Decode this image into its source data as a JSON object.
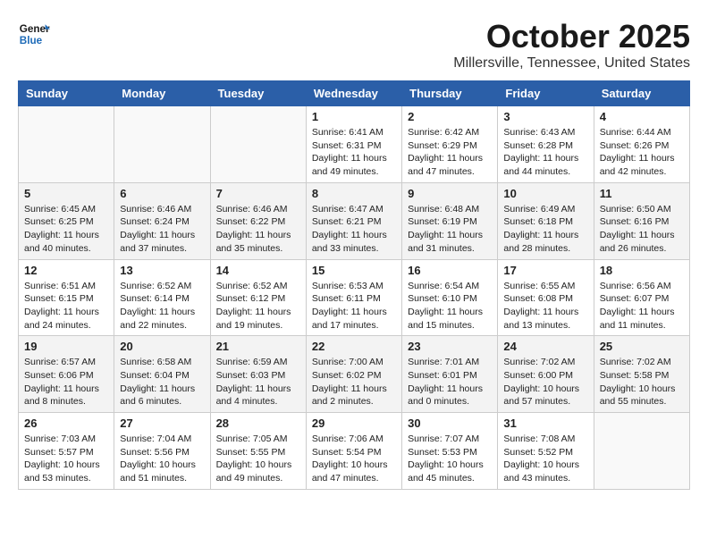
{
  "header": {
    "logo_line1": "General",
    "logo_line2": "Blue",
    "month_title": "October 2025",
    "location": "Millersville, Tennessee, United States"
  },
  "days_of_week": [
    "Sunday",
    "Monday",
    "Tuesday",
    "Wednesday",
    "Thursday",
    "Friday",
    "Saturday"
  ],
  "weeks": [
    [
      {
        "day": "",
        "info": ""
      },
      {
        "day": "",
        "info": ""
      },
      {
        "day": "",
        "info": ""
      },
      {
        "day": "1",
        "info": "Sunrise: 6:41 AM\nSunset: 6:31 PM\nDaylight: 11 hours\nand 49 minutes."
      },
      {
        "day": "2",
        "info": "Sunrise: 6:42 AM\nSunset: 6:29 PM\nDaylight: 11 hours\nand 47 minutes."
      },
      {
        "day": "3",
        "info": "Sunrise: 6:43 AM\nSunset: 6:28 PM\nDaylight: 11 hours\nand 44 minutes."
      },
      {
        "day": "4",
        "info": "Sunrise: 6:44 AM\nSunset: 6:26 PM\nDaylight: 11 hours\nand 42 minutes."
      }
    ],
    [
      {
        "day": "5",
        "info": "Sunrise: 6:45 AM\nSunset: 6:25 PM\nDaylight: 11 hours\nand 40 minutes."
      },
      {
        "day": "6",
        "info": "Sunrise: 6:46 AM\nSunset: 6:24 PM\nDaylight: 11 hours\nand 37 minutes."
      },
      {
        "day": "7",
        "info": "Sunrise: 6:46 AM\nSunset: 6:22 PM\nDaylight: 11 hours\nand 35 minutes."
      },
      {
        "day": "8",
        "info": "Sunrise: 6:47 AM\nSunset: 6:21 PM\nDaylight: 11 hours\nand 33 minutes."
      },
      {
        "day": "9",
        "info": "Sunrise: 6:48 AM\nSunset: 6:19 PM\nDaylight: 11 hours\nand 31 minutes."
      },
      {
        "day": "10",
        "info": "Sunrise: 6:49 AM\nSunset: 6:18 PM\nDaylight: 11 hours\nand 28 minutes."
      },
      {
        "day": "11",
        "info": "Sunrise: 6:50 AM\nSunset: 6:16 PM\nDaylight: 11 hours\nand 26 minutes."
      }
    ],
    [
      {
        "day": "12",
        "info": "Sunrise: 6:51 AM\nSunset: 6:15 PM\nDaylight: 11 hours\nand 24 minutes."
      },
      {
        "day": "13",
        "info": "Sunrise: 6:52 AM\nSunset: 6:14 PM\nDaylight: 11 hours\nand 22 minutes."
      },
      {
        "day": "14",
        "info": "Sunrise: 6:52 AM\nSunset: 6:12 PM\nDaylight: 11 hours\nand 19 minutes."
      },
      {
        "day": "15",
        "info": "Sunrise: 6:53 AM\nSunset: 6:11 PM\nDaylight: 11 hours\nand 17 minutes."
      },
      {
        "day": "16",
        "info": "Sunrise: 6:54 AM\nSunset: 6:10 PM\nDaylight: 11 hours\nand 15 minutes."
      },
      {
        "day": "17",
        "info": "Sunrise: 6:55 AM\nSunset: 6:08 PM\nDaylight: 11 hours\nand 13 minutes."
      },
      {
        "day": "18",
        "info": "Sunrise: 6:56 AM\nSunset: 6:07 PM\nDaylight: 11 hours\nand 11 minutes."
      }
    ],
    [
      {
        "day": "19",
        "info": "Sunrise: 6:57 AM\nSunset: 6:06 PM\nDaylight: 11 hours\nand 8 minutes."
      },
      {
        "day": "20",
        "info": "Sunrise: 6:58 AM\nSunset: 6:04 PM\nDaylight: 11 hours\nand 6 minutes."
      },
      {
        "day": "21",
        "info": "Sunrise: 6:59 AM\nSunset: 6:03 PM\nDaylight: 11 hours\nand 4 minutes."
      },
      {
        "day": "22",
        "info": "Sunrise: 7:00 AM\nSunset: 6:02 PM\nDaylight: 11 hours\nand 2 minutes."
      },
      {
        "day": "23",
        "info": "Sunrise: 7:01 AM\nSunset: 6:01 PM\nDaylight: 11 hours\nand 0 minutes."
      },
      {
        "day": "24",
        "info": "Sunrise: 7:02 AM\nSunset: 6:00 PM\nDaylight: 10 hours\nand 57 minutes."
      },
      {
        "day": "25",
        "info": "Sunrise: 7:02 AM\nSunset: 5:58 PM\nDaylight: 10 hours\nand 55 minutes."
      }
    ],
    [
      {
        "day": "26",
        "info": "Sunrise: 7:03 AM\nSunset: 5:57 PM\nDaylight: 10 hours\nand 53 minutes."
      },
      {
        "day": "27",
        "info": "Sunrise: 7:04 AM\nSunset: 5:56 PM\nDaylight: 10 hours\nand 51 minutes."
      },
      {
        "day": "28",
        "info": "Sunrise: 7:05 AM\nSunset: 5:55 PM\nDaylight: 10 hours\nand 49 minutes."
      },
      {
        "day": "29",
        "info": "Sunrise: 7:06 AM\nSunset: 5:54 PM\nDaylight: 10 hours\nand 47 minutes."
      },
      {
        "day": "30",
        "info": "Sunrise: 7:07 AM\nSunset: 5:53 PM\nDaylight: 10 hours\nand 45 minutes."
      },
      {
        "day": "31",
        "info": "Sunrise: 7:08 AM\nSunset: 5:52 PM\nDaylight: 10 hours\nand 43 minutes."
      },
      {
        "day": "",
        "info": ""
      }
    ]
  ]
}
